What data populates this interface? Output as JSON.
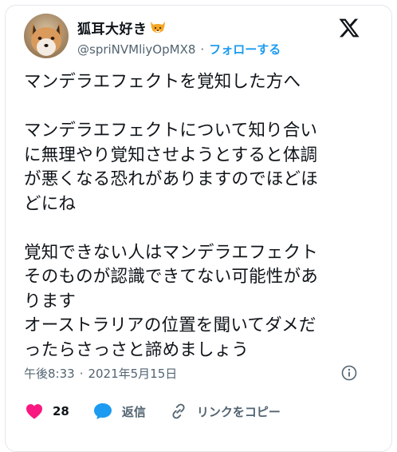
{
  "author": {
    "display_name": "狐耳大好き",
    "handle": "@spriNVMliyOpMX8",
    "separator": "·",
    "follow_label": "フォローする"
  },
  "tweet": {
    "lines": [
      "マンデラエフェクトを覚知した方へ",
      "",
      "マンデラエフェクトについて知り合い",
      "に無理やり覚知させようとすると体調",
      "が悪くなる恐れがありますのでほどほ",
      "どにね",
      "",
      "覚知できない人はマンデラエフェクト",
      "そのものが認識できてない可能性があ",
      "ります",
      "オーストラリアの位置を聞いてダメだ",
      "ったらさっさと諦めましょう"
    ]
  },
  "meta": {
    "time": "午後8:33",
    "separator": "·",
    "date": "2021年5月15日"
  },
  "actions": {
    "likes_count": "28",
    "reply_label": "返信",
    "copy_link_label": "リンクをコピー"
  },
  "icons": {
    "avatar": "fox-avatar",
    "emoji": "fox-face-emoji",
    "logo": "x-logo-icon",
    "info": "info-icon",
    "like": "heart-icon",
    "reply": "speech-bubble-icon",
    "link": "link-icon"
  },
  "colors": {
    "like": "#f91880",
    "reply": "#1d9bf0",
    "follow": "#1d9bf0",
    "secondary_text": "#536471",
    "primary_text": "#0f1419"
  }
}
